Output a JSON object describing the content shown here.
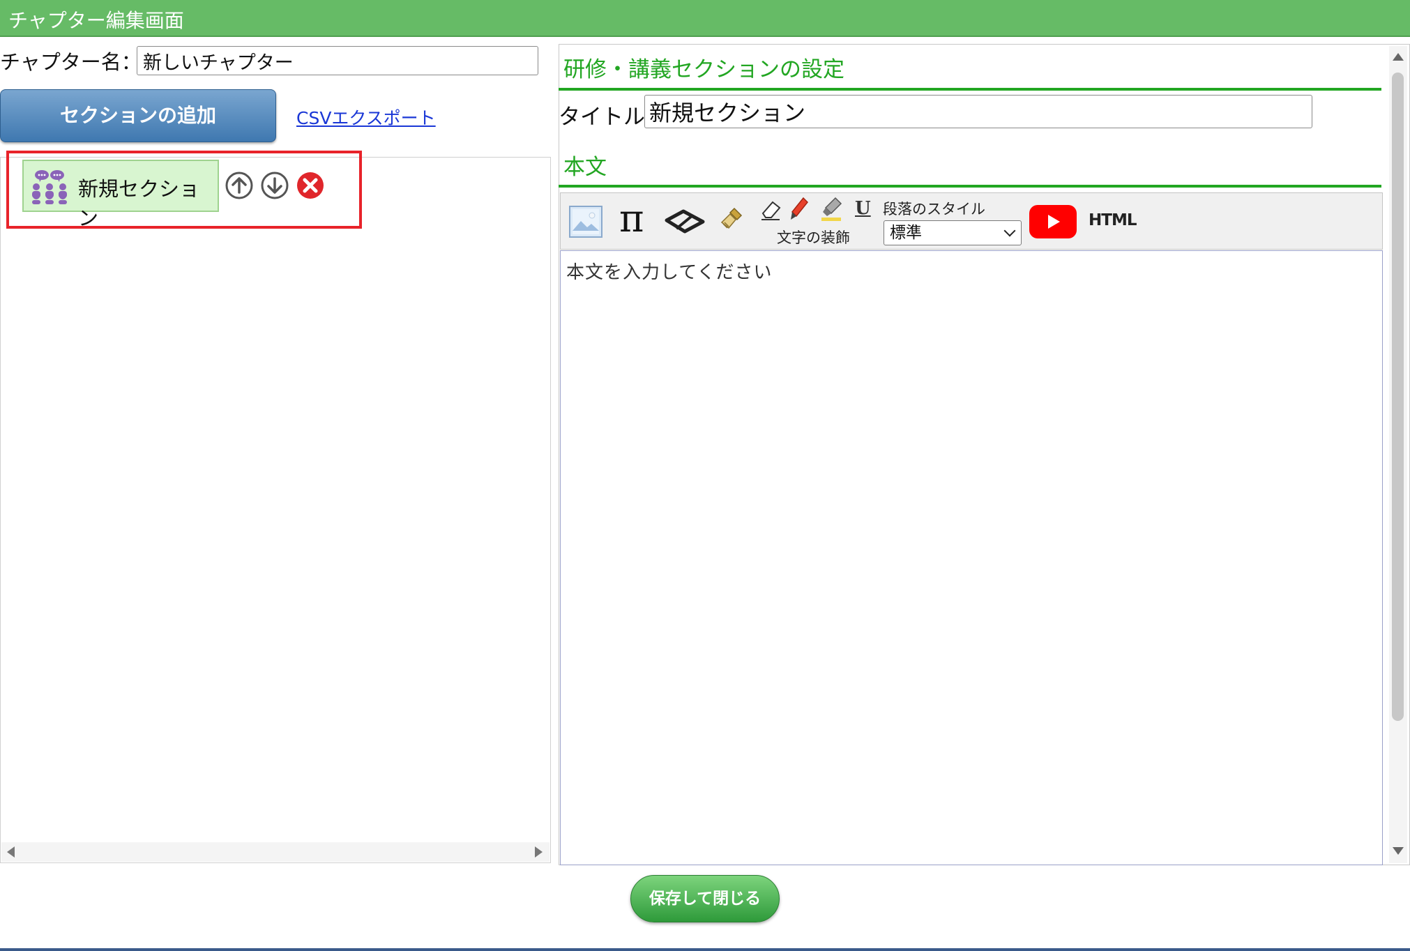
{
  "window": {
    "title": "チャプター編集画面"
  },
  "left": {
    "chapter_label": "チャプター名：",
    "chapter_value": "新しいチャプター",
    "add_section_label": "セクションの追加",
    "csv_export_label": "CSVエクスポート",
    "sections": [
      {
        "label": "新規セクション",
        "icon": "people-icon"
      }
    ]
  },
  "right": {
    "settings_heading": "研修・講義セクションの設定",
    "title_label": "タイトル:",
    "title_value": "新規セクション",
    "body_heading": "本文",
    "toolbar": {
      "pi_glyph": "π",
      "underline_glyph": "U",
      "decoration_label": "文字の装飾",
      "paragraph_style_label": "段落のスタイル",
      "paragraph_style_value": "標準",
      "html_label": "HTML"
    },
    "editor_placeholder": "本文を入力してください"
  },
  "footer": {
    "save_close_label": "保存して閉じる"
  },
  "colors": {
    "titlebar": "#66bb66",
    "heading_green": "#22a622",
    "add_button_blue": "#3f78b0",
    "highlight_red": "#e8232a",
    "section_item_bg": "#d8f5d0"
  }
}
